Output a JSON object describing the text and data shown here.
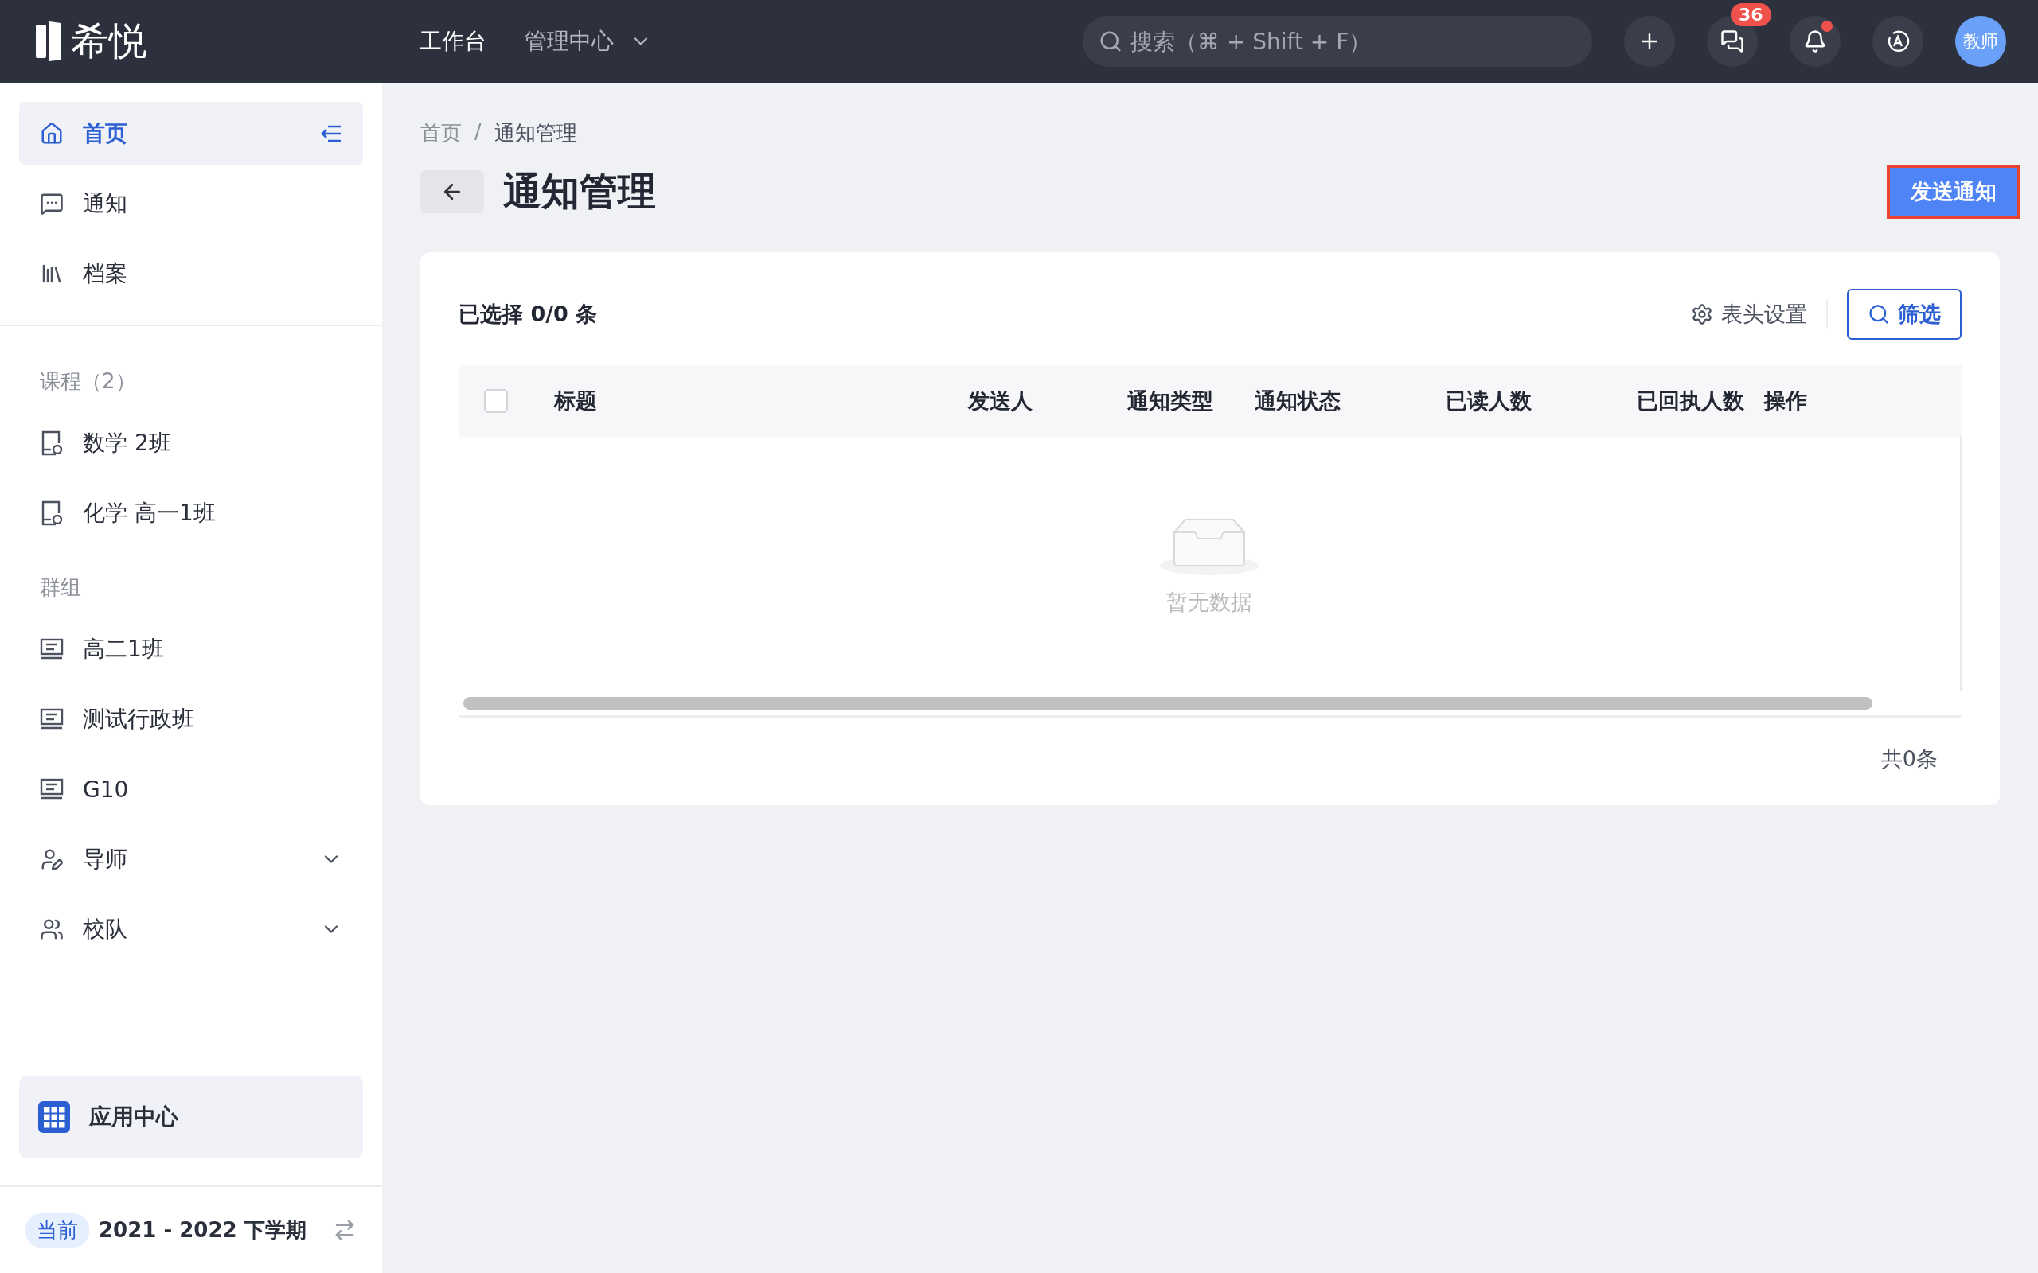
{
  "topbar": {
    "logo": "希悦",
    "nav": [
      {
        "label": "工作台",
        "selected": true,
        "dropdown": false
      },
      {
        "label": "管理中心",
        "selected": false,
        "dropdown": true
      }
    ],
    "search": {
      "placeholder": "搜索（⌘ + Shift + F）"
    },
    "messages_badge": "36",
    "notifications_unread": true,
    "avatar": "教师"
  },
  "sidebar": {
    "main_items": [
      {
        "label": "首页",
        "kind": "home",
        "selected": true
      },
      {
        "label": "通知",
        "kind": "chat",
        "selected": false
      },
      {
        "label": "档案",
        "kind": "archive",
        "selected": false
      }
    ],
    "sections": [
      {
        "title": "课程（2）",
        "items": [
          {
            "label": "数学 2班",
            "kind": "course",
            "selected": false
          },
          {
            "label": "化学 高一1班",
            "kind": "course",
            "selected": false
          }
        ]
      },
      {
        "title": "群组",
        "items": [
          {
            "label": "高二1班",
            "kind": "group",
            "selected": false
          },
          {
            "label": "测试行政班",
            "kind": "group",
            "selected": false
          },
          {
            "label": "G10",
            "kind": "group",
            "selected": false
          },
          {
            "label": "导师",
            "kind": "mentor",
            "selected": false,
            "expanded": false
          },
          {
            "label": "校队",
            "kind": "team",
            "selected": false,
            "expanded": false
          }
        ]
      }
    ],
    "app_center": "应用中心",
    "term": {
      "tag": "当前",
      "label": "2021 - 2022 下学期"
    }
  },
  "breadcrumb": {
    "separator": "/",
    "items": [
      "首页",
      "通知管理"
    ]
  },
  "title": "通知管理",
  "send_button": {
    "label": "发送通知",
    "outlined": true
  },
  "table": {
    "selection": "已选择 0/0 条",
    "column_settings": "表头设置",
    "filter": "筛选",
    "select_all_checked": false,
    "columns": [
      "标题",
      "发送人",
      "通知类型",
      "通知状态",
      "已读人数",
      "已回执人数",
      "操作"
    ],
    "empty_text": "暂无数据",
    "total": "共0条"
  }
}
